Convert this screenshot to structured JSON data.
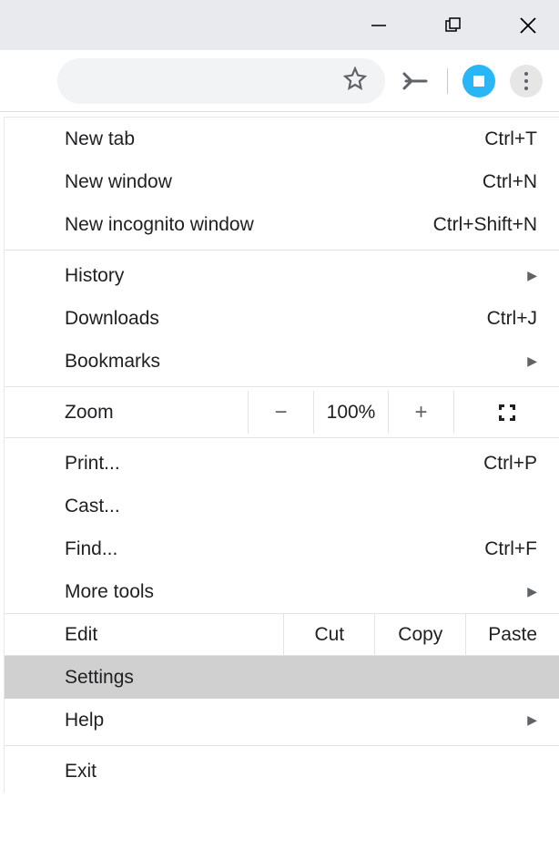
{
  "window": {
    "minimize": "minimize",
    "maximize": "maximize",
    "close": "close"
  },
  "toolbar": {
    "star": "star",
    "ext1": "airplane",
    "ext2": "extension",
    "menu": "menu"
  },
  "menu": {
    "new_tab": {
      "label": "New tab",
      "shortcut": "Ctrl+T"
    },
    "new_window": {
      "label": "New window",
      "shortcut": "Ctrl+N"
    },
    "new_incognito": {
      "label": "New incognito window",
      "shortcut": "Ctrl+Shift+N"
    },
    "history": {
      "label": "History"
    },
    "downloads": {
      "label": "Downloads",
      "shortcut": "Ctrl+J"
    },
    "bookmarks": {
      "label": "Bookmarks"
    },
    "zoom": {
      "label": "Zoom",
      "value": "100%",
      "minus": "−",
      "plus": "+"
    },
    "print": {
      "label": "Print...",
      "shortcut": "Ctrl+P"
    },
    "cast": {
      "label": "Cast..."
    },
    "find": {
      "label": "Find...",
      "shortcut": "Ctrl+F"
    },
    "more_tools": {
      "label": "More tools"
    },
    "edit": {
      "label": "Edit",
      "cut": "Cut",
      "copy": "Copy",
      "paste": "Paste"
    },
    "settings": {
      "label": "Settings"
    },
    "help": {
      "label": "Help"
    },
    "exit": {
      "label": "Exit"
    }
  }
}
